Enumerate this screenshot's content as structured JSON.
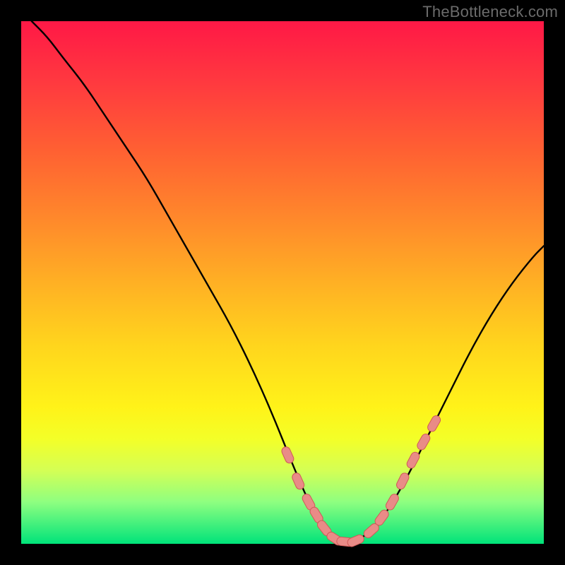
{
  "watermark": "TheBottleneck.com",
  "colors": {
    "background": "#000000",
    "curve": "#000000",
    "marker_fill": "#e98b87",
    "marker_stroke": "#cf5a57"
  },
  "chart_data": {
    "type": "line",
    "title": "",
    "xlabel": "",
    "ylabel": "",
    "xlim": [
      0,
      100
    ],
    "ylim": [
      0,
      100
    ],
    "grid": false,
    "series": [
      {
        "name": "bottleneck-curve",
        "x": [
          2,
          5,
          8,
          12,
          16,
          20,
          24,
          28,
          32,
          36,
          40,
          44,
          48,
          52,
          55,
          58,
          61,
          63,
          66,
          70,
          74,
          78,
          82,
          86,
          90,
          94,
          98,
          100
        ],
        "y": [
          100,
          97,
          93,
          88,
          82,
          76,
          70,
          63,
          56,
          49,
          42,
          34,
          25,
          15,
          8,
          3,
          0.6,
          0.3,
          1.5,
          6,
          13,
          21,
          29,
          37,
          44,
          50,
          55,
          57
        ]
      }
    ],
    "markers": {
      "name": "highlighted-points",
      "x": [
        51,
        53,
        55,
        56.5,
        58,
        60,
        62,
        64,
        67,
        69,
        71,
        73,
        75,
        77,
        79
      ],
      "y": [
        17,
        12,
        8,
        5.5,
        3,
        1,
        0.4,
        0.6,
        2.5,
        5,
        8,
        12,
        16,
        19.5,
        23
      ]
    },
    "gradient_stops": [
      {
        "pos": 0.0,
        "color": "#ff1846"
      },
      {
        "pos": 0.12,
        "color": "#ff3a3f"
      },
      {
        "pos": 0.25,
        "color": "#ff6132"
      },
      {
        "pos": 0.38,
        "color": "#ff892b"
      },
      {
        "pos": 0.5,
        "color": "#ffb024"
      },
      {
        "pos": 0.62,
        "color": "#ffd51d"
      },
      {
        "pos": 0.74,
        "color": "#fff319"
      },
      {
        "pos": 0.8,
        "color": "#f3ff28"
      },
      {
        "pos": 0.86,
        "color": "#d4ff55"
      },
      {
        "pos": 0.92,
        "color": "#8eff80"
      },
      {
        "pos": 1.0,
        "color": "#00e37a"
      }
    ]
  }
}
